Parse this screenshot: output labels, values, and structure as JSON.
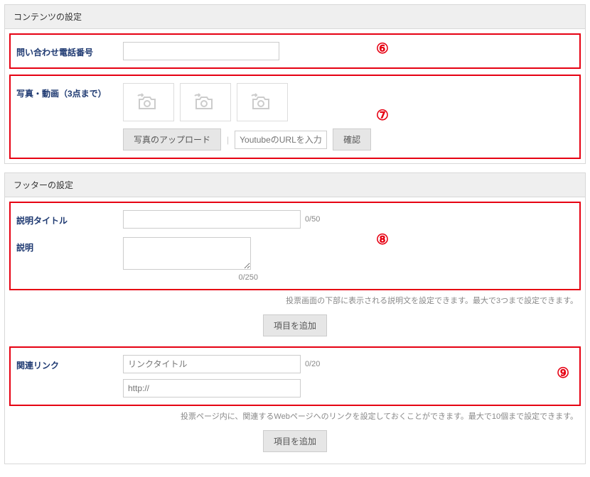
{
  "sections": {
    "content": {
      "title": "コンテンツの設定"
    },
    "footer": {
      "title": "フッターの設定"
    }
  },
  "rows": {
    "phone": {
      "label": "問い合わせ電話番号"
    },
    "media": {
      "label": "写真・動画（3点まで）"
    },
    "descTitle": {
      "label": "説明タイトル",
      "counter": "0/50"
    },
    "desc": {
      "label": "説明",
      "counter": "0/250"
    },
    "link": {
      "label": "関連リンク",
      "counter": "0/20"
    }
  },
  "buttons": {
    "uploadPhoto": "写真のアップロード",
    "confirm": "確認",
    "addItem": "項目を追加"
  },
  "placeholders": {
    "youtube": "YoutubeのURLを入力",
    "linkTitle": "リンクタイトル",
    "linkUrl": "http://"
  },
  "helps": {
    "desc": "投票画面の下部に表示される説明文を設定できます。最大で3つまで設定できます。",
    "link": "投票ページ内に、関連するWebページへのリンクを設定しておくことができます。最大で10個まで設定できます。"
  },
  "annotations": {
    "a6": "⑥",
    "a7": "⑦",
    "a8": "⑧",
    "a9": "⑨"
  }
}
